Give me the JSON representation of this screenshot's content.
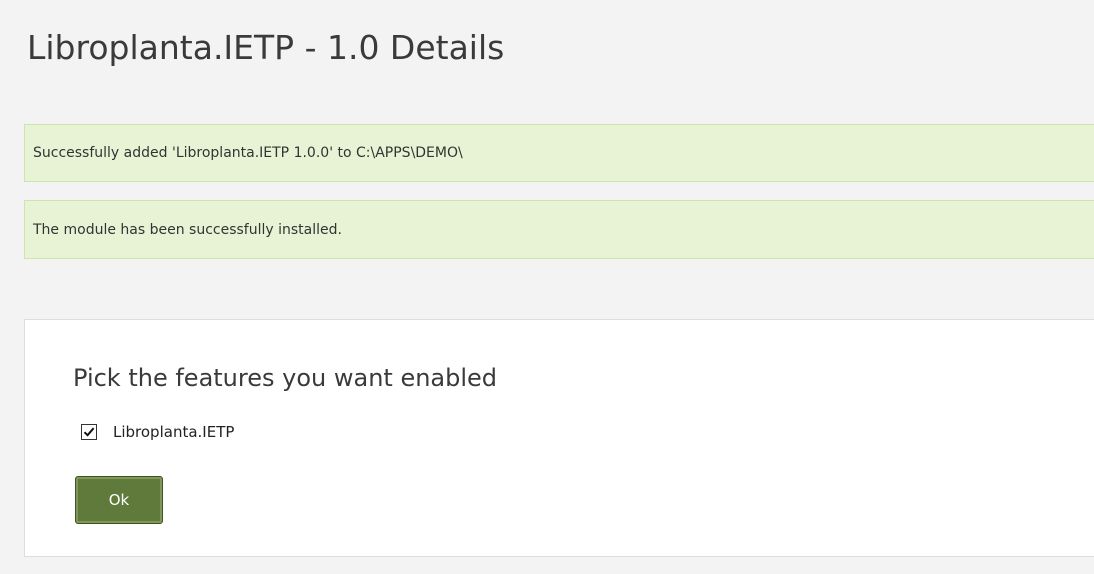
{
  "page": {
    "title": "Libroplanta.IETP - 1.0 Details"
  },
  "alerts": [
    {
      "text": "Successfully added 'Libroplanta.IETP 1.0.0' to C:\\APPS\\DEMO\\"
    },
    {
      "text": "The module has been successfully installed."
    }
  ],
  "features_panel": {
    "heading": "Pick the features you want enabled",
    "features": [
      {
        "label": "Libroplanta.IETP",
        "checked": true
      }
    ],
    "ok_label": "Ok"
  },
  "colors": {
    "alert_background": "#e8f3d6",
    "button_background": "#5f7a3a",
    "page_background": "#f3f3f3"
  },
  "icons": {
    "checkbox_checked": "checkmark-icon"
  }
}
